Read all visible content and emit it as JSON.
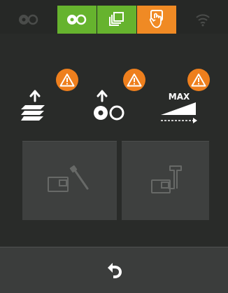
{
  "topbar": {
    "tabs": [
      {
        "icon": "reel-icon",
        "state": "inactive"
      },
      {
        "icon": "reel-icon",
        "state": "active",
        "color": "#66b32e"
      },
      {
        "icon": "stack-icon",
        "state": "active",
        "color": "#66b32e"
      },
      {
        "icon": "hand-icon",
        "state": "selected",
        "color": "#f08a24"
      },
      {
        "icon": "wifi-icon",
        "state": "inactive"
      }
    ]
  },
  "warnings": [
    {
      "icon": "paper-stack-up-icon",
      "badge": "warning-icon"
    },
    {
      "icon": "reel-up-icon",
      "badge": "warning-icon"
    },
    {
      "icon": "max-level-icon",
      "label": "MAX",
      "badge": "warning-icon"
    }
  ],
  "buttons": [
    {
      "icon": "card-brush-icon",
      "state": "disabled"
    },
    {
      "icon": "card-stand-icon",
      "state": "disabled"
    }
  ],
  "bottombar": {
    "icon": "back-arrow-icon"
  },
  "colors": {
    "background": "#292b29",
    "green": "#66b32e",
    "orange": "#f08a24",
    "warning": "#ee7f1d",
    "button": "#3e403f",
    "bottombar": "#3b3d3c"
  }
}
